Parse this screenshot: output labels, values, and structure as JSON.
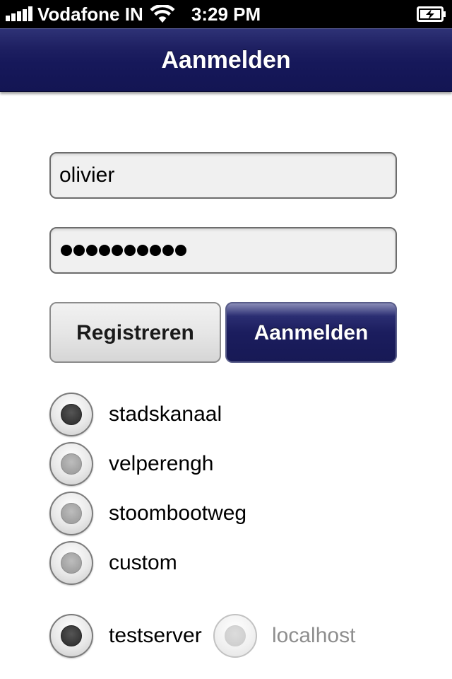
{
  "status_bar": {
    "carrier": "Vodafone IN",
    "time": "3:29 PM",
    "signal_bars": 5,
    "wifi_icon": "wifi-icon",
    "battery_icon": "battery-charging-icon"
  },
  "nav": {
    "title": "Aanmelden"
  },
  "login_form": {
    "username_value": "olivier",
    "password_length": 10,
    "register_label": "Registreren",
    "login_label": "Aanmelden"
  },
  "servers": [
    {
      "label": "stadskanaal",
      "checked": true
    },
    {
      "label": "velperengh",
      "checked": false
    },
    {
      "label": "stoombootweg",
      "checked": false
    },
    {
      "label": "custom",
      "checked": false
    }
  ],
  "environment": [
    {
      "label": "testserver",
      "checked": true,
      "enabled": true
    },
    {
      "label": "localhost",
      "checked": false,
      "enabled": false
    }
  ],
  "colors": {
    "nav_background": "#1a1c5c",
    "primary_button": "#1b1d5e",
    "field_background": "#f0f0f0",
    "muted_text": "#8e8e8e"
  }
}
